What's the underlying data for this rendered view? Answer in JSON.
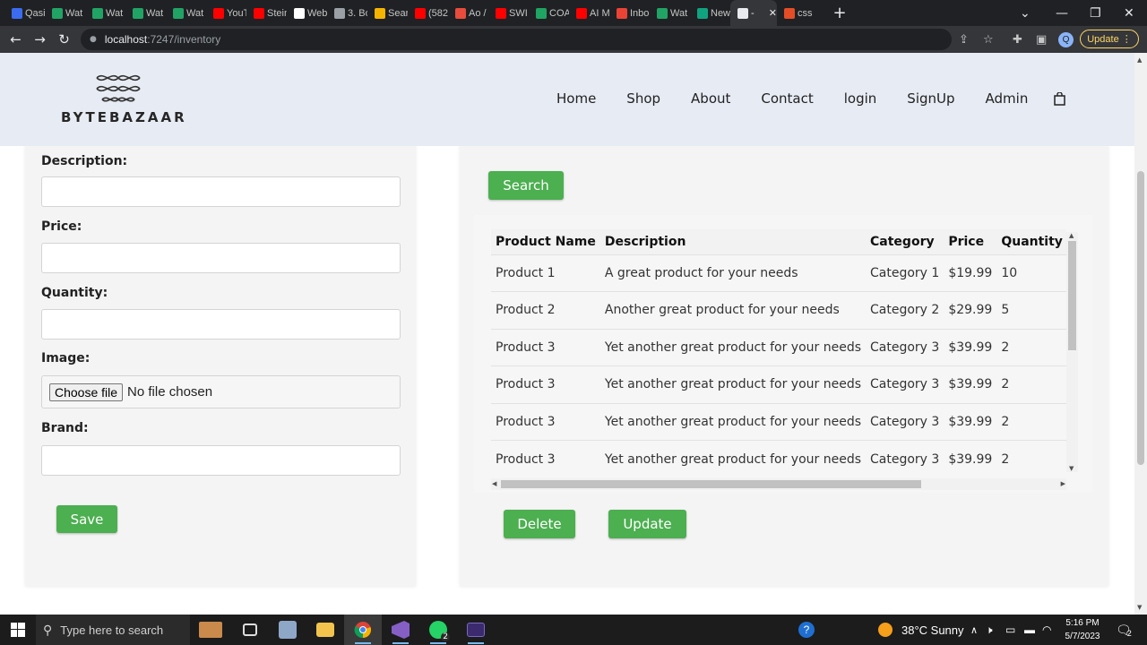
{
  "browser": {
    "tabs": [
      {
        "title": "Qasi",
        "color": "#3b6cf0"
      },
      {
        "title": "Wat",
        "color": "#21a366"
      },
      {
        "title": "Wat",
        "color": "#21a366"
      },
      {
        "title": "Wat",
        "color": "#21a366"
      },
      {
        "title": "Wat",
        "color": "#21a366"
      },
      {
        "title": "YouT",
        "color": "#ff0000"
      },
      {
        "title": "Stein",
        "color": "#ff0000"
      },
      {
        "title": "Web",
        "color": "#ffffff"
      },
      {
        "title": "3. Bo",
        "color": "#9aa0a6"
      },
      {
        "title": "Sear",
        "color": "#f5b400"
      },
      {
        "title": "(582",
        "color": "#ff0000"
      },
      {
        "title": "Ao /",
        "color": "#e74c3c"
      },
      {
        "title": "SWI",
        "color": "#ff0000"
      },
      {
        "title": "COA",
        "color": "#1fa463"
      },
      {
        "title": "AI M",
        "color": "#ff0000"
      },
      {
        "title": "Inbo",
        "color": "#ea4335"
      },
      {
        "title": "Wat",
        "color": "#21a366"
      },
      {
        "title": "New",
        "color": "#10a37f"
      },
      {
        "title": "-",
        "color": "#e8eaed"
      },
      {
        "title": "css",
        "color": "#e44d26"
      }
    ],
    "url_host": "localhost",
    "url_path": ":7247/inventory",
    "update_label": "Update",
    "profile_initial": "Q"
  },
  "site": {
    "brand": "BYTEBAZAAR",
    "nav": [
      "Home",
      "Shop",
      "About",
      "Contact",
      "login",
      "SignUp",
      "Admin"
    ]
  },
  "form": {
    "description_label": "Description:",
    "price_label": "Price:",
    "quantity_label": "Quantity:",
    "image_label": "Image:",
    "choose_file_label": "Choose file",
    "no_file_text": "No file chosen",
    "brand_label": "Brand:",
    "save_label": "Save"
  },
  "inventory": {
    "search_label": "Search",
    "columns": [
      "Product Name",
      "Description",
      "Category",
      "Price",
      "Quantity"
    ],
    "rows": [
      [
        "Product 1",
        "A great product for your needs",
        "Category 1",
        "$19.99",
        "10"
      ],
      [
        "Product 2",
        "Another great product for your needs",
        "Category 2",
        "$29.99",
        "5"
      ],
      [
        "Product 3",
        "Yet another great product for your needs",
        "Category 3",
        "$39.99",
        "2"
      ],
      [
        "Product 3",
        "Yet another great product for your needs",
        "Category 3",
        "$39.99",
        "2"
      ],
      [
        "Product 3",
        "Yet another great product for your needs",
        "Category 3",
        "$39.99",
        "2"
      ],
      [
        "Product 3",
        "Yet another great product for your needs",
        "Category 3",
        "$39.99",
        "2"
      ]
    ],
    "delete_label": "Delete",
    "update_label": "Update",
    "button_color": "#4caf50"
  },
  "taskbar": {
    "search_placeholder": "Type here to search",
    "weather": "38°C  Sunny",
    "time": "5:16 PM",
    "date": "5/7/2023",
    "whatsapp_badge": "2",
    "notification_badge": "2"
  }
}
